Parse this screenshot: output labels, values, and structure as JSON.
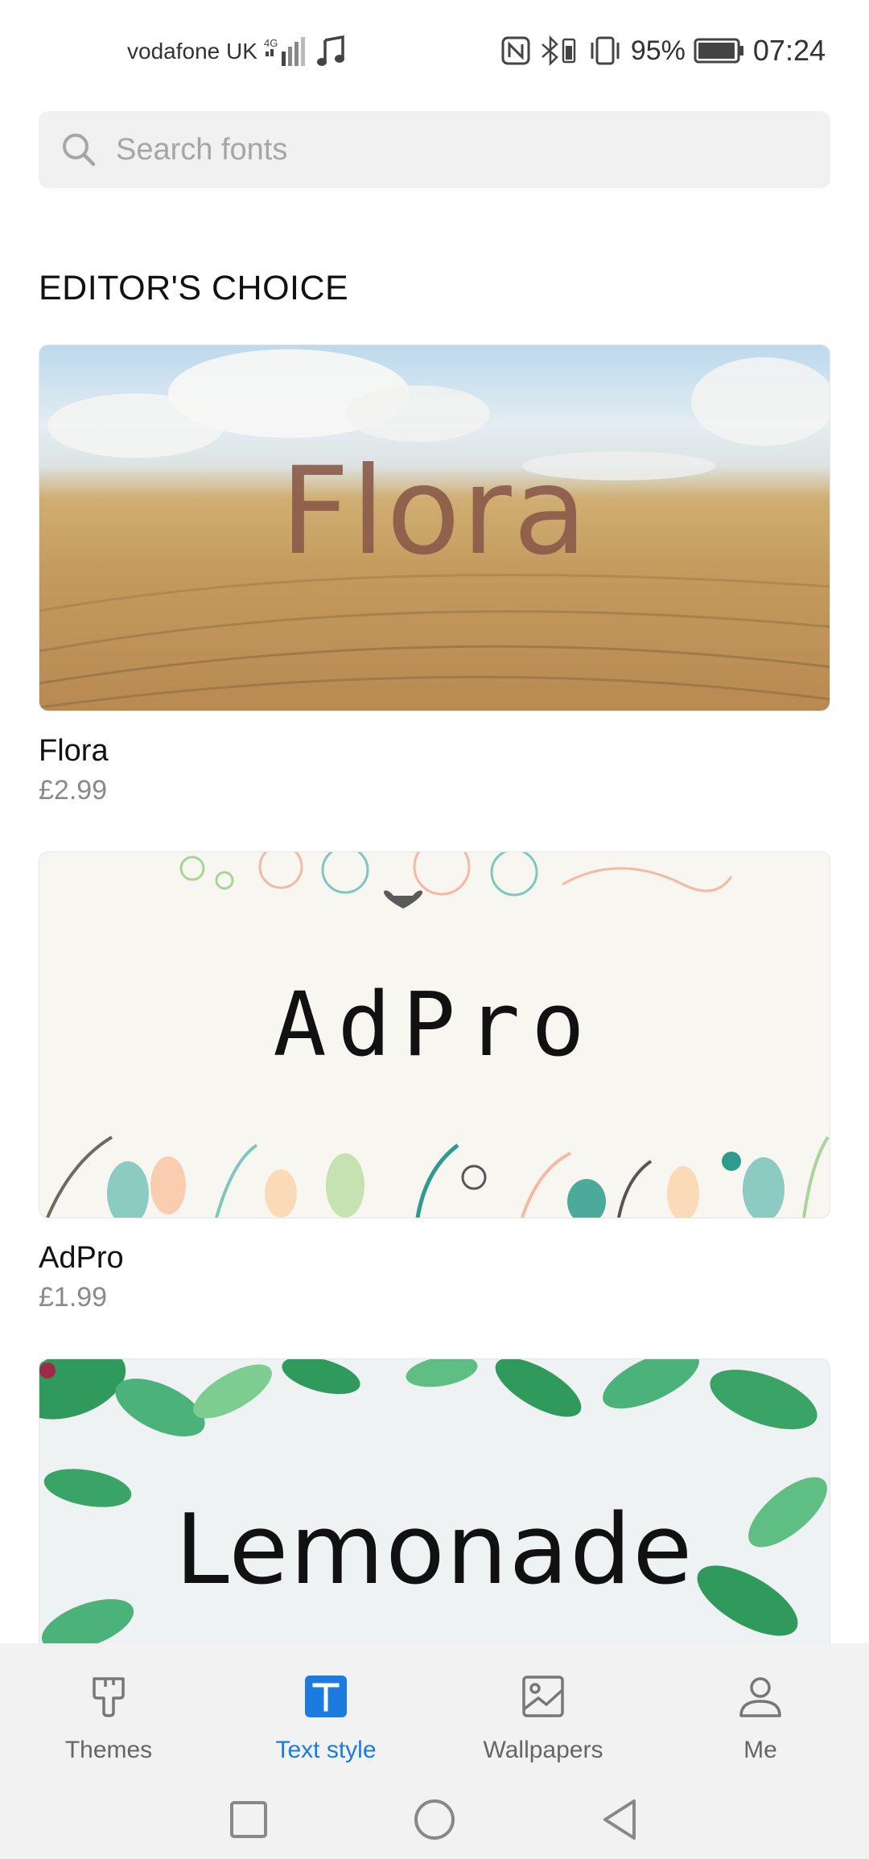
{
  "status_bar": {
    "carrier": "vodafone UK",
    "network": "4G",
    "battery": "95%",
    "time": "07:24"
  },
  "search": {
    "placeholder": "Search fonts",
    "value": ""
  },
  "section": {
    "title": "EDITOR'S CHOICE"
  },
  "fonts": [
    {
      "name": "Flora",
      "price": "£2.99",
      "banner_text": "Flora"
    },
    {
      "name": "AdPro",
      "price": "£1.99",
      "banner_text": "AdPro"
    },
    {
      "name": "Lemonade",
      "price": "",
      "banner_text": "Lemonade"
    }
  ],
  "bottom_nav": {
    "items": [
      {
        "label": "Themes",
        "icon": "paint-brush-icon",
        "active": false
      },
      {
        "label": "Text style",
        "icon": "text-t-icon",
        "active": true
      },
      {
        "label": "Wallpapers",
        "icon": "image-icon",
        "active": false
      },
      {
        "label": "Me",
        "icon": "person-icon",
        "active": false
      }
    ]
  },
  "colors": {
    "accent": "#1b7bdf",
    "nav_background": "#f2f2f2",
    "search_background": "#f1f1f1",
    "price_gray": "#8a8a8a"
  }
}
